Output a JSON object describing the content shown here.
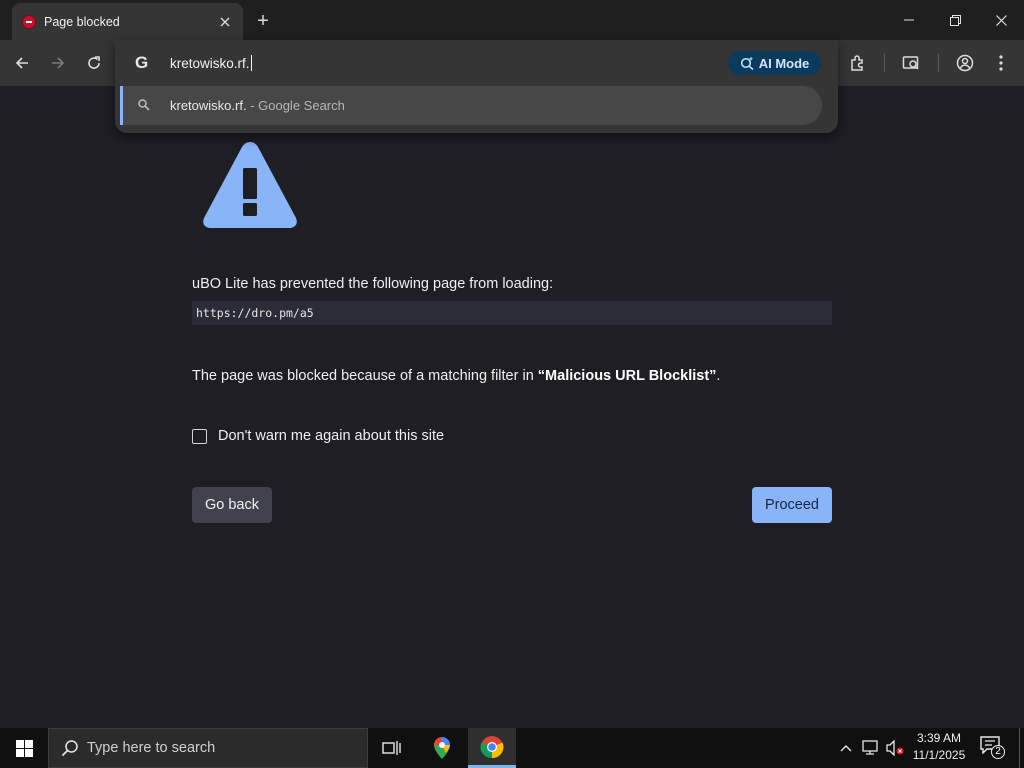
{
  "browser": {
    "tab": {
      "title": "Page blocked"
    },
    "omnibox": {
      "value": "kretowisko.rf.",
      "ai_mode_label": "AI Mode",
      "suggestion": {
        "query": "kretowisko.rf.",
        "suffix": " - Google Search"
      }
    }
  },
  "page": {
    "message": "uBO Lite has prevented the following page from loading:",
    "blocked_url": "https://dro.pm/a5",
    "reason_prefix": "The page was blocked because of a matching filter in ",
    "reason_list": "“Malicious URL Blocklist”",
    "reason_suffix": ".",
    "checkbox_label": "Don't warn me again about this site",
    "checkbox_checked": false,
    "go_back_label": "Go back",
    "proceed_label": "Proceed",
    "accent_color": "#8ab4f8"
  },
  "taskbar": {
    "search_placeholder": "Type here to search",
    "time": "3:39 AM",
    "date": "11/1/2025",
    "notification_count": "2"
  }
}
